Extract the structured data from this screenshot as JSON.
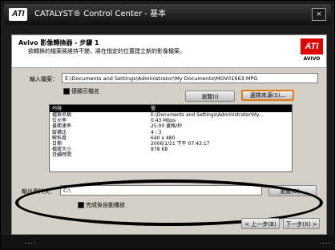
{
  "window": {
    "logo": "ATI",
    "title": "CATALYST® Control Center - 基本",
    "close": "×"
  },
  "dialog": {
    "title": "Avivo 影像轉換器 - 步驟 1",
    "description": "欲轉換的檔案將維持不變，將在指定的位置建立新的影像檔案。",
    "logo_text": "ATI",
    "logo_sub": "AVIVO"
  },
  "input_file": {
    "label": "輸入檔案：",
    "value": "E:\\Documents and Settings\\Administrator\\My Documents\\MOV01663.MPG"
  },
  "show_extension": {
    "label": "僅顯示檔名"
  },
  "buttons": {
    "browse": "瀏覽(I)",
    "select_source": "選擇來源(S)...",
    "output_browse": "瀏覽(O)...",
    "back": "< 上一步(B)",
    "next": "下一步(X) >"
  },
  "table": {
    "headers": [
      "內容",
      "值"
    ],
    "rows": [
      [
        "檔案名稱",
        "E:\\Documents and Settings\\Administrator\\My..."
      ],
      [
        "位元率",
        "0.43 Mbps"
      ],
      [
        "畫面速率",
        "25.00 畫格/秒"
      ],
      [
        "縱橫比",
        "4 : 3"
      ],
      [
        "解析度",
        "640 x 480"
      ],
      [
        "日期",
        "2006/1/21 下午 07:43:17"
      ],
      [
        "檔案大小",
        "878 KB"
      ],
      [
        "持續時間",
        ""
      ]
    ]
  },
  "output_folder": {
    "label": "輸出資料夾：",
    "value": "C:\\"
  },
  "auto_check": {
    "label": "完成後自動播放"
  },
  "taskbar": {
    "left_dots": "....",
    "right_dots": "...."
  }
}
